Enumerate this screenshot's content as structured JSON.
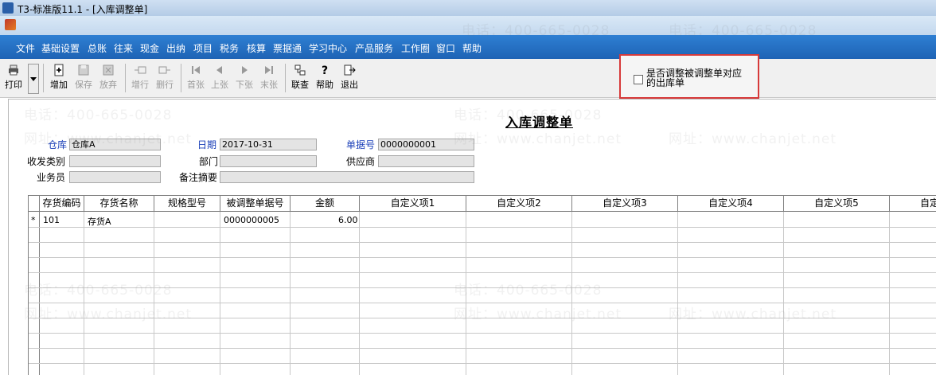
{
  "window": {
    "title": "T3-标准版11.1 - [入库调整单]"
  },
  "menu": [
    "文件",
    "基础设置",
    "总账",
    "往来",
    "现金",
    "出纳",
    "项目",
    "税务",
    "核算",
    "票据通",
    "学习中心",
    "产品服务",
    "工作圈",
    "窗口",
    "帮助"
  ],
  "toolbar": {
    "print": "打印",
    "add": "增加",
    "save": "保存",
    "abandon": "放弃",
    "add_row": "增行",
    "delete_row": "删行",
    "first": "首张",
    "prev": "上张",
    "next": "下张",
    "last": "末张",
    "link_query": "联查",
    "help": "帮助",
    "exit": "退出"
  },
  "checkbox": {
    "label": "是否调整被调整单对应的出库单",
    "checked": false
  },
  "form": {
    "title": "入库调整单",
    "warehouse_label": "仓库",
    "warehouse_value": "仓库A",
    "date_label": "日期",
    "date_value": "2017-10-31",
    "doc_no_label": "单据号",
    "doc_no_value": "0000000001",
    "category_label": "收发类别",
    "department_label": "部门",
    "supplier_label": "供应商",
    "salesperson_label": "业务员",
    "remark_label": "备注摘要"
  },
  "grid": {
    "columns": [
      "存货编码",
      "存货名称",
      "规格型号",
      "被调整单据号",
      "金额",
      "自定义项1",
      "自定义项2",
      "自定义项3",
      "自定义项4",
      "自定义项5",
      "自定"
    ],
    "rows": [
      {
        "marker": "*",
        "code": "101",
        "name": "存货A",
        "spec": "",
        "ref_no": "0000000005",
        "amount": "6.00"
      }
    ]
  },
  "watermark": {
    "phone": "电话：400-665-0028",
    "web": "网址：www.chanjet.net"
  },
  "colors": {
    "menubar": "#1e63b5",
    "highlight_border": "#d73a3a",
    "label_blue": "#1a3fb8"
  }
}
